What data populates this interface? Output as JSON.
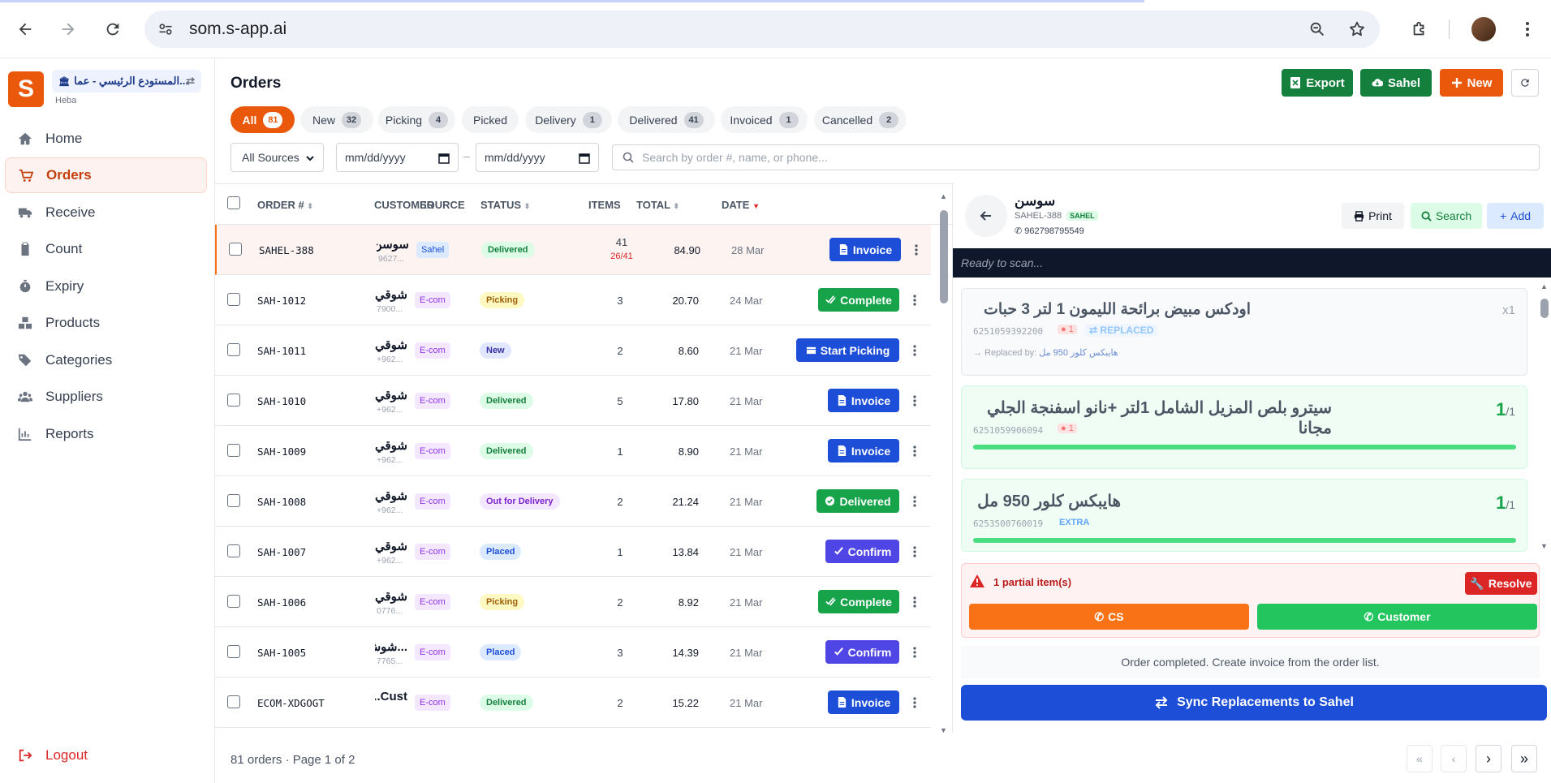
{
  "browser": {
    "url": "som.s-app.ai"
  },
  "sidebar": {
    "logo_letter": "S",
    "store_name": "...المستودع الرئيسي - عمان",
    "user_name": "Heba",
    "items": [
      {
        "label": "Home",
        "icon": "home-icon"
      },
      {
        "label": "Orders",
        "icon": "cart-icon",
        "active": true
      },
      {
        "label": "Receive",
        "icon": "truck-icon"
      },
      {
        "label": "Count",
        "icon": "clipboard-icon"
      },
      {
        "label": "Expiry",
        "icon": "stopwatch-icon"
      },
      {
        "label": "Products",
        "icon": "boxes-icon"
      },
      {
        "label": "Categories",
        "icon": "tags-icon"
      },
      {
        "label": "Suppliers",
        "icon": "users-icon"
      },
      {
        "label": "Reports",
        "icon": "chart-icon"
      }
    ],
    "logout_label": "Logout"
  },
  "header": {
    "title": "Orders",
    "buttons": {
      "export": "Export",
      "sahel": "Sahel",
      "new": "New"
    }
  },
  "colors": {
    "accent": "#ea580c",
    "green": "#16a34a",
    "blue": "#1d4ed8",
    "indigo": "#4f46e5",
    "teal": "#059669"
  },
  "tabs": [
    {
      "label": "All",
      "count": "81",
      "active": true
    },
    {
      "label": "New",
      "count": "32"
    },
    {
      "label": "Picking",
      "count": "4"
    },
    {
      "label": "Picked",
      "count": ""
    },
    {
      "label": "Delivery",
      "count": "1"
    },
    {
      "label": "Delivered",
      "count": "41"
    },
    {
      "label": "Invoiced",
      "count": "1"
    },
    {
      "label": "Cancelled",
      "count": "2"
    }
  ],
  "filters": {
    "source_value": "All Sources",
    "date_from_placeholder": "mm/dd/yyyy",
    "date_to_placeholder": "mm/dd/yyyy",
    "date_sep": "–",
    "search_placeholder": "Search by order #, name, or phone..."
  },
  "table": {
    "columns": {
      "order": "ORDER #",
      "customer": "CUSTOMER",
      "source": "SOURCE",
      "status": "STATUS",
      "items": "ITEMS",
      "total": "TOTAL",
      "date": "DATE"
    },
    "rows": [
      {
        "order": "SAHEL-388",
        "customer": "سوسن",
        "phone": "9627...",
        "source": "Sahel",
        "status": "Delivered",
        "items": "41",
        "items_sub": "26/41",
        "total": "84.90",
        "date": "28 Mar",
        "action": "Invoice"
      },
      {
        "order": "SAH-1012",
        "customer": "شوقي",
        "phone": "7900...",
        "source": "E-com",
        "status": "Picking",
        "items": "3",
        "total": "20.70",
        "date": "24 Mar",
        "action": "Complete"
      },
      {
        "order": "SAH-1011",
        "customer": "شوقي",
        "phone": "+962...",
        "source": "E-com",
        "status": "New",
        "items": "2",
        "total": "8.60",
        "date": "21 Mar",
        "action": "Start Picking"
      },
      {
        "order": "SAH-1010",
        "customer": "شوقي",
        "phone": "+962...",
        "source": "E-com",
        "status": "Delivered",
        "items": "5",
        "total": "17.80",
        "date": "21 Mar",
        "action": "Invoice"
      },
      {
        "order": "SAH-1009",
        "customer": "شوقي",
        "phone": "+962...",
        "source": "E-com",
        "status": "Delivered",
        "items": "1",
        "total": "8.90",
        "date": "21 Mar",
        "action": "Invoice"
      },
      {
        "order": "SAH-1008",
        "customer": "شوقي",
        "phone": "+962...",
        "source": "E-com",
        "status": "Out for Delivery",
        "items": "2",
        "total": "21.24",
        "date": "21 Mar",
        "action": "Delivered"
      },
      {
        "order": "SAH-1007",
        "customer": "شوقي",
        "phone": "+962...",
        "source": "E-com",
        "status": "Placed",
        "items": "1",
        "total": "13.84",
        "date": "21 Mar",
        "action": "Confirm"
      },
      {
        "order": "SAH-1006",
        "customer": "شوقي",
        "phone": "0776...",
        "source": "E-com",
        "status": "Picking",
        "items": "2",
        "total": "8.92",
        "date": "21 Mar",
        "action": "Complete"
      },
      {
        "order": "SAH-1005",
        "customer": "...شوش",
        "phone": "7765...",
        "source": "E-com",
        "status": "Placed",
        "items": "3",
        "total": "14.39",
        "date": "21 Mar",
        "action": "Confirm"
      },
      {
        "order": "ECOM-XDGOGT",
        "customer": "Cust...",
        "phone": "",
        "source": "E-com",
        "status": "Delivered",
        "items": "2",
        "total": "15.22",
        "date": "21 Mar",
        "action": "Invoice"
      }
    ]
  },
  "footer": {
    "summary": "81 orders · Page 1 of 2"
  },
  "panel": {
    "customer_name": "سوسن",
    "order_id": "SAHEL-388",
    "source_tag": "SAHEL",
    "phone": "962798795549",
    "buttons": {
      "print": "Print",
      "search": "Search",
      "add": "Add"
    },
    "scan_placeholder": "Ready to scan...",
    "items": [
      {
        "name": "اودكس مبيض برائحة الليمون 1 لتر 3 حبات",
        "barcode": "6251059392200",
        "loc": "1",
        "badge": "REPLACED",
        "qty_right": "x1",
        "replaced_by_label": "Replaced by:",
        "replaced_by": "هايبكس كلور 950 مل"
      },
      {
        "name": "سيترو بلص المزيل الشامل 1لتر +نانو اسفنجة الجلي مجانا",
        "barcode": "6251059906094",
        "loc": "1",
        "qty": "1",
        "qty_total": "/1",
        "progress": 1.0
      },
      {
        "name": "هايبكس كلور 950 مل",
        "barcode": "6253500760019",
        "badge": "EXTRA",
        "qty": "1",
        "qty_total": "/1",
        "progress": 1.0
      }
    ],
    "alert_text": "1 partial item(s)",
    "resolve_label": "Resolve",
    "cs_label": "CS",
    "customer_label": "Customer",
    "note": "Order completed. Create invoice from the order list.",
    "sync_label": "Sync Replacements to Sahel"
  }
}
